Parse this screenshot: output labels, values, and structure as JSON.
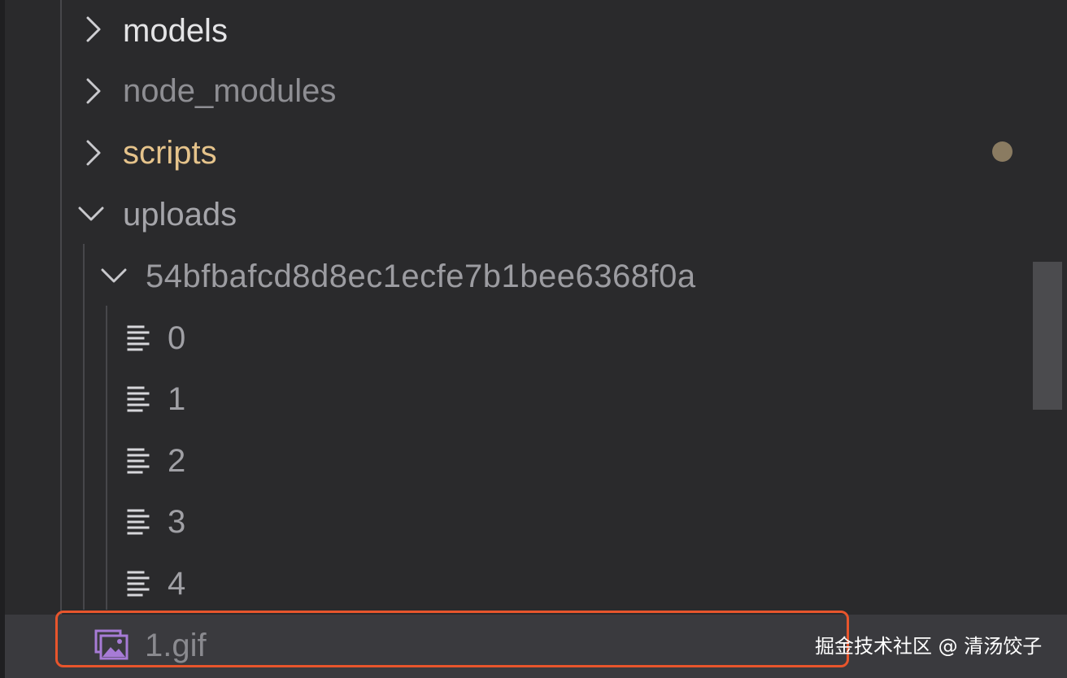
{
  "explorer": {
    "items": [
      {
        "label": "models",
        "kind": "folder",
        "expanded": false,
        "icon": "chevron-right-icon"
      },
      {
        "label": "node_modules",
        "kind": "folder",
        "expanded": false,
        "icon": "chevron-right-icon"
      },
      {
        "label": "scripts",
        "kind": "folder",
        "expanded": false,
        "icon": "chevron-right-icon",
        "status": "modified",
        "status_color": "#8a7b61"
      },
      {
        "label": "uploads",
        "kind": "folder",
        "expanded": true,
        "icon": "chevron-down-icon"
      },
      {
        "label": "54bfbafcd8d8ec1ecfe7b1bee6368f0a",
        "kind": "folder",
        "expanded": true,
        "icon": "chevron-down-icon"
      },
      {
        "label": "0",
        "kind": "file",
        "icon": "text-file-icon"
      },
      {
        "label": "1",
        "kind": "file",
        "icon": "text-file-icon"
      },
      {
        "label": "2",
        "kind": "file",
        "icon": "text-file-icon"
      },
      {
        "label": "3",
        "kind": "file",
        "icon": "text-file-icon"
      },
      {
        "label": "4",
        "kind": "file",
        "icon": "text-file-icon"
      },
      {
        "label": "1.gif",
        "kind": "file",
        "icon": "image-file-icon",
        "selected": true
      }
    ]
  },
  "highlight": {
    "color": "#e8552c"
  },
  "watermark": {
    "text": "掘金技术社区 @ 清汤饺子"
  },
  "colors": {
    "background": "#2a2a2c",
    "selected_row": "#3a3a3e",
    "folder_scripts": "#e5c38b",
    "image_icon": "#a77bd6"
  }
}
